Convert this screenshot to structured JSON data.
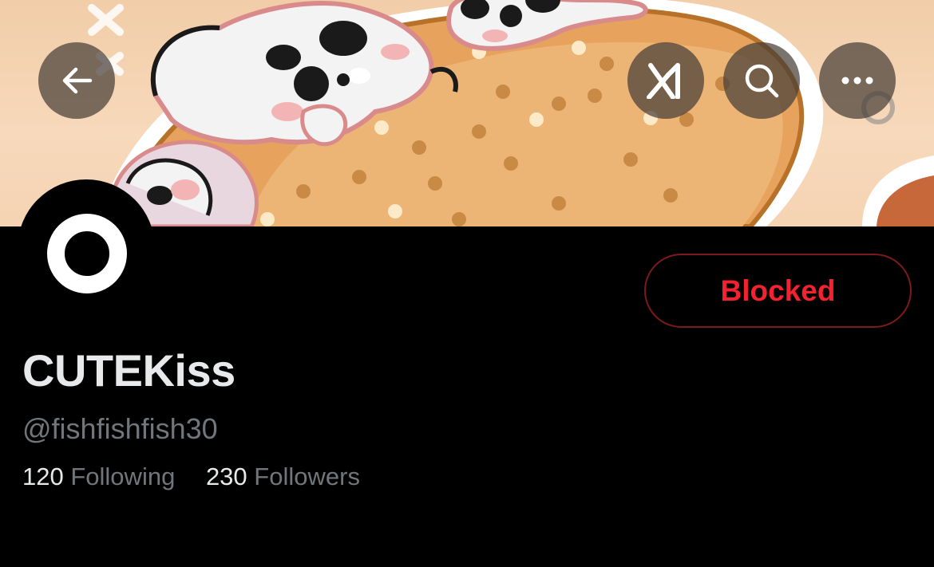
{
  "header": {
    "back_icon": "arrow-left-icon",
    "grok_icon": "grok-icon",
    "search_icon": "search-icon",
    "more_icon": "more-horizontal-icon",
    "button_bg": "#463e37"
  },
  "profile": {
    "display_name": "CUTEKiss",
    "handle": "@fishfishfish30",
    "blocked_label": "Blocked",
    "following_count": "120",
    "following_label": "Following",
    "followers_count": "230",
    "followers_label": "Followers"
  },
  "colors": {
    "background": "#000000",
    "name": "#e7e9ea",
    "secondary_text": "#71767b",
    "blocked_red": "#f4212e",
    "blocked_border": "#7d1a1a"
  }
}
